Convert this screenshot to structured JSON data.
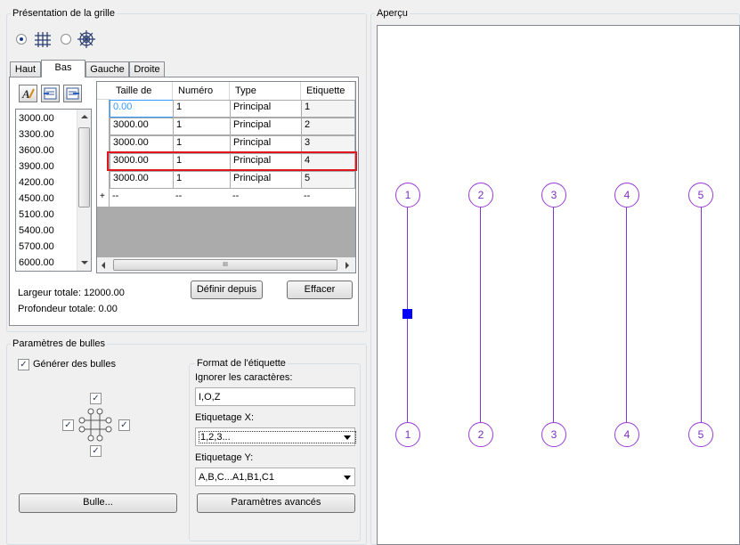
{
  "grid_group": {
    "title": "Présentation de la grille"
  },
  "tabs": [
    {
      "label": "Haut"
    },
    {
      "label": "Bas"
    },
    {
      "label": "Gauche"
    },
    {
      "label": "Droite"
    }
  ],
  "spacing_list": [
    "3000.00",
    "3300.00",
    "3600.00",
    "3900.00",
    "4200.00",
    "4500.00",
    "5100.00",
    "5400.00",
    "5700.00",
    "6000.00"
  ],
  "table": {
    "headers": [
      "Taille de",
      "Numéro",
      "Type",
      "Etiquette"
    ],
    "rows": [
      [
        "0.00",
        "1",
        "Principal",
        "1"
      ],
      [
        "3000.00",
        "1",
        "Principal",
        "2"
      ],
      [
        "3000.00",
        "1",
        "Principal",
        "3"
      ],
      [
        "3000.00",
        "1",
        "Principal",
        "4"
      ],
      [
        "3000.00",
        "1",
        "Principal",
        "5"
      ]
    ],
    "new_row_marker": "+",
    "new_row": [
      "--",
      "--",
      "--",
      "--"
    ],
    "scroll_grip": "III"
  },
  "totals": {
    "width": "Largeur totale: 12000.00",
    "depth": "Profondeur totale: 0.00"
  },
  "buttons": {
    "define_from": "Définir depuis",
    "clear": "Effacer",
    "bubble": "Bulle...",
    "advanced": "Paramètres avancés"
  },
  "bubble_group": {
    "title": "Paramètres de bulles",
    "generate_label": "Générer des bulles",
    "label_format_title": "Format de l'étiquette",
    "ignore_chars_label": "Ignorer les caractères:",
    "ignore_chars_value": "I,O,Z",
    "labeling_x_label": "Etiquetage X:",
    "labeling_x_value": "1,2,3...",
    "labeling_y_label": "Etiquetage Y:",
    "labeling_y_value": "A,B,C...A1,B1,C1"
  },
  "preview": {
    "title": "Aperçu",
    "labels": [
      "1",
      "2",
      "3",
      "4",
      "5"
    ],
    "line_color": "#7b3ad0",
    "selection_color": "#0000ff"
  }
}
